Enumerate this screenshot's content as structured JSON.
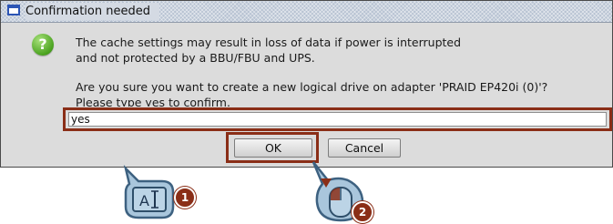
{
  "dialog": {
    "title": "Confirmation needed",
    "icon": "question-icon",
    "icon_glyph": "?",
    "message_lines": [
      "The cache settings may result in loss of data if power is interrupted",
      "and not protected by a BBU/FBU and UPS."
    ],
    "question_lines": [
      "Are you sure you want to create a new logical drive on adapter 'PRAID EP420i (0)'?",
      "Please type yes to confirm."
    ],
    "input_value": "yes",
    "ok_label": "OK",
    "cancel_label": "Cancel"
  },
  "callouts": {
    "keyboard_label": "A",
    "keyboard_icon": "text-input-icon",
    "mouse_icon": "mouse-click-icon",
    "badge_1": "1",
    "badge_2": "2"
  },
  "colors": {
    "highlight": "#8a2e17",
    "callout_fill": "#a9c6dc",
    "callout_stroke": "#3d6180",
    "titlebar": "#b7c2d2",
    "dialog_bg": "#dcdcdc"
  }
}
